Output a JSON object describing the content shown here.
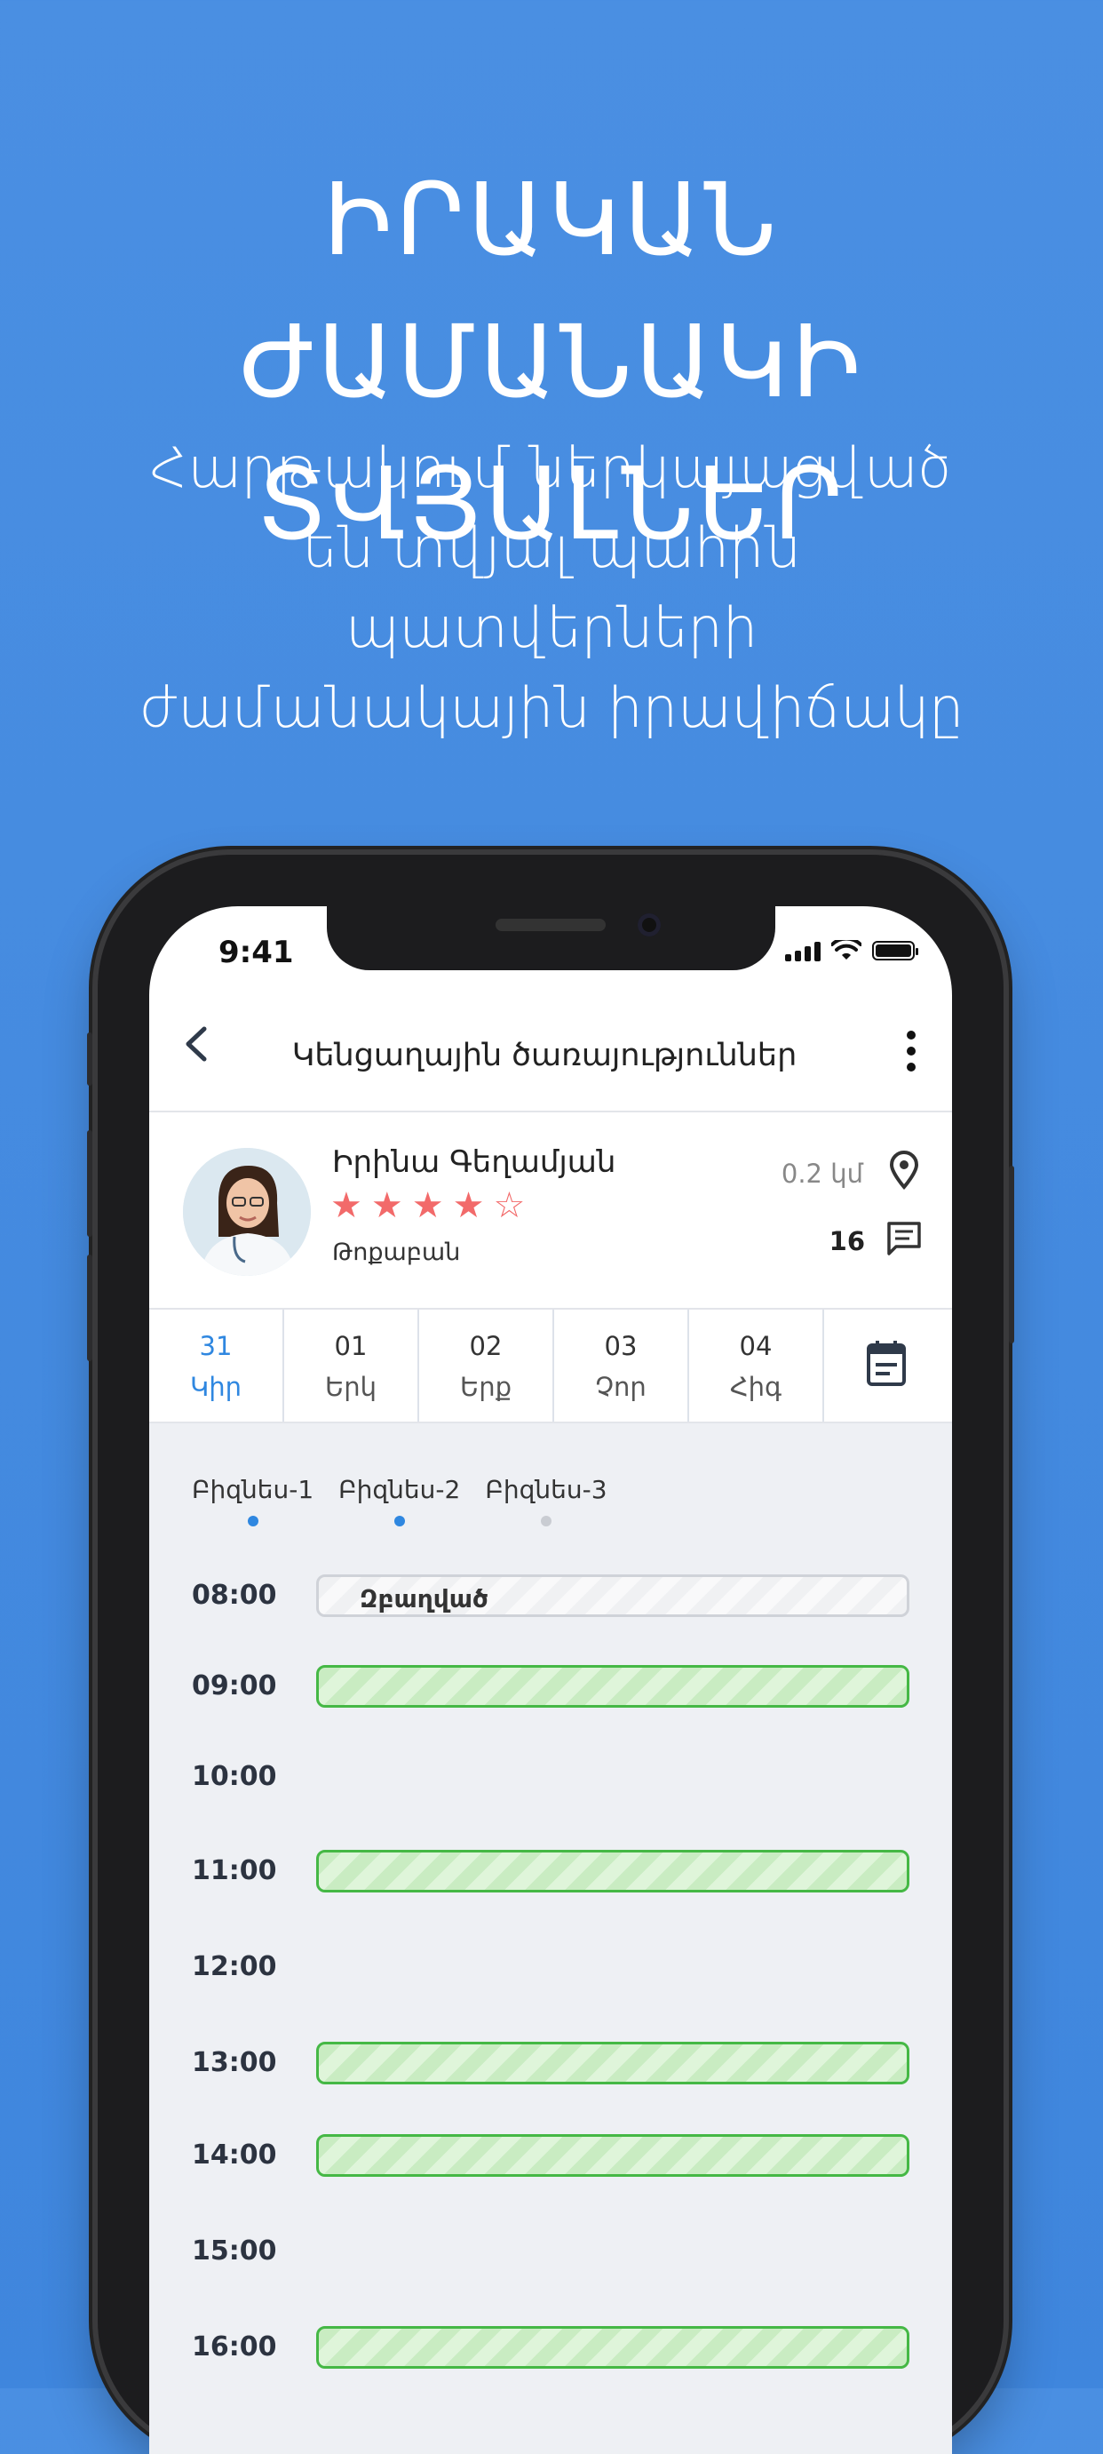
{
  "headline": [
    "ԻՐԱԿԱՆ ԺԱՄԱՆԱԿԻ",
    "ՏՎՅԱԼՆԵՐ"
  ],
  "subline": [
    "Հարթակում ներկայացված",
    "են տվյալ պահին",
    "պատվերների",
    "ժամանակային իրավիճակը"
  ],
  "status": {
    "time": "9:41"
  },
  "nav": {
    "title": "Կենցաղային ծառայություններ"
  },
  "doctor": {
    "name": "Իրինա Գեղամյան",
    "role": "Թոքաբան",
    "rating": 4,
    "rating_max": 5,
    "distance": "0.2 կմ",
    "messages": "16"
  },
  "days": [
    {
      "num": "31",
      "name": "Կիր",
      "active": true
    },
    {
      "num": "01",
      "name": "Երկ"
    },
    {
      "num": "02",
      "name": "Երք"
    },
    {
      "num": "03",
      "name": "Չոր"
    },
    {
      "num": "04",
      "name": "Հիգ"
    }
  ],
  "business_tabs": [
    {
      "label": "Բիզնես-1",
      "dot": "active"
    },
    {
      "label": "Բիզնես-2",
      "dot": "active"
    },
    {
      "label": "Բիզնես-3",
      "dot": "inactive"
    }
  ],
  "schedule": [
    {
      "time": "08:00",
      "state": "busy",
      "label": "Զբաղված"
    },
    {
      "time": "09:00",
      "state": "free"
    },
    {
      "time": "10:00",
      "state": "none"
    },
    {
      "time": "11:00",
      "state": "free"
    },
    {
      "time": "12:00",
      "state": "none"
    },
    {
      "time": "13:00",
      "state": "free"
    },
    {
      "time": "14:00",
      "state": "free"
    },
    {
      "time": "15:00",
      "state": "none"
    },
    {
      "time": "16:00",
      "state": "free"
    }
  ],
  "colors": {
    "accent": "#2f87e0",
    "star": "#f26a6a",
    "free_slot": "#45b845",
    "background": "#4a8fe2"
  }
}
